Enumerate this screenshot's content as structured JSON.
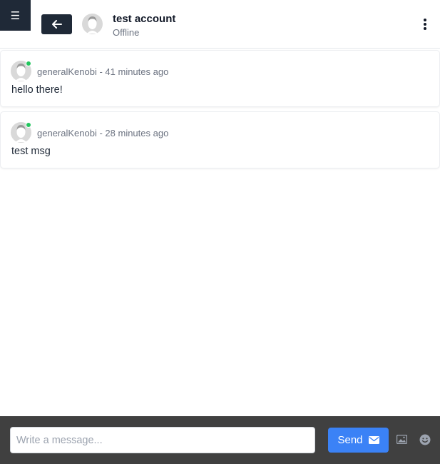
{
  "header": {
    "menu_icon": "hamburger-icon",
    "back_icon": "arrow-left-icon",
    "contact_name": "test account",
    "contact_status": "Offline",
    "more_icon": "kebab-icon"
  },
  "messages": [
    {
      "author": "generalKenobi",
      "time": " - 41 minutes ago",
      "text": "hello there!",
      "online": true
    },
    {
      "author": "generalKenobi",
      "time": " - 28 minutes ago",
      "text": "test msg",
      "online": true
    }
  ],
  "composer": {
    "placeholder": "Write a message...",
    "value": "",
    "send_label": "Send",
    "send_icon": "envelope-icon",
    "image_icon": "image-icon",
    "emoji_icon": "smiley-icon"
  },
  "colors": {
    "dark": "#1f2937",
    "accent": "#3b82f6",
    "online": "#22c55e",
    "composer_bg": "#404040"
  }
}
